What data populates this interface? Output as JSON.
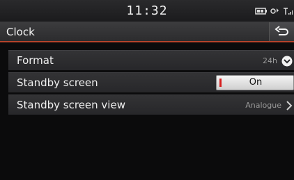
{
  "statusbar": {
    "time": "11:32",
    "icons": [
      "battery-icon",
      "bluetooth-audio-icon",
      "signal-icon"
    ]
  },
  "header": {
    "title": "Clock",
    "back_icon": "back-arrow-icon"
  },
  "settings": [
    {
      "label": "Format",
      "value": "24h",
      "control": "dropdown"
    },
    {
      "label": "Standby screen",
      "value": "On",
      "control": "toggle"
    },
    {
      "label": "Standby screen view",
      "value": "Analogue",
      "control": "submenu"
    }
  ],
  "colors": {
    "accent": "#b5432c",
    "toggle_indicator": "#d61f1f"
  }
}
